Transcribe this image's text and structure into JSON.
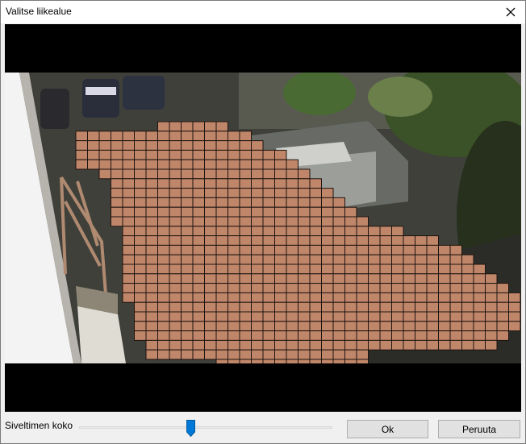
{
  "dialog": {
    "title": "Valitse liikealue",
    "close_icon": "close-icon"
  },
  "video": {
    "overlay_color": "#c0866a",
    "image_description_icon": "camera-feed"
  },
  "brush": {
    "label": "Siveltimen koko",
    "level": 0.44
  },
  "buttons": {
    "ok_label": "Ok",
    "cancel_label": "Peruuta"
  }
}
